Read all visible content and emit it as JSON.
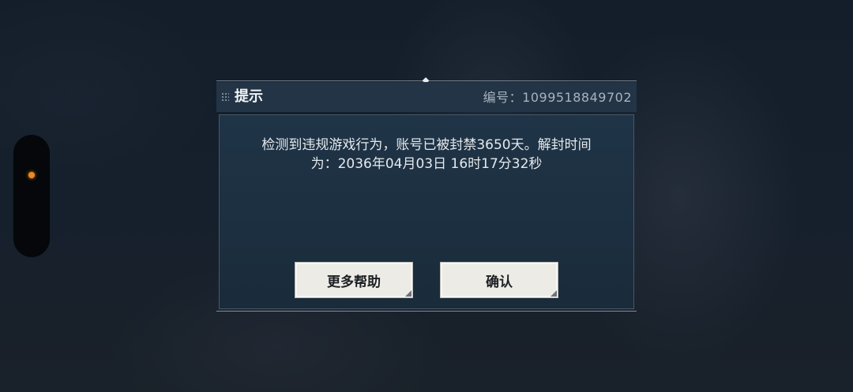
{
  "dialog": {
    "title": "提示",
    "serial_label": "编号：1099518849702",
    "message_line1": "检测到违规游戏行为，账号已被封禁3650天。解封时间",
    "message_line2": "为：2036年04月03日 16时17分32秒"
  },
  "buttons": {
    "help_label": "更多帮助",
    "confirm_label": "确认"
  },
  "colors": {
    "header_bg": "#223446",
    "panel_bg": "#1f3447",
    "button_bg": "#ecebe6",
    "status_dot": "#f08a1d"
  },
  "icons": {
    "grip": "drag-grip-icon",
    "top_marker": "diamond-marker-icon",
    "button_corner": "corner-triangle-icon"
  }
}
